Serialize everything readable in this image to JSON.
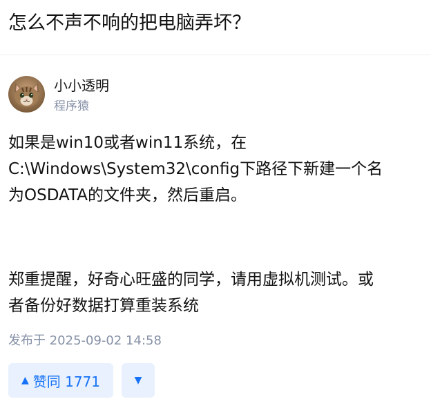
{
  "question": {
    "title": "怎么不声不响的把电脑弄坏？"
  },
  "author": {
    "name": "小小透明",
    "headline": "程序猿",
    "avatar_icon": "cat-avatar-icon"
  },
  "answer": {
    "paragraphs": [
      "如果是win10或者win11系统，在\nC:\\Windows\\System32\\config下路径下新建一个名\n为OSDATA的文件夹，然后重启。",
      "郑重提醒，好奇心旺盛的同学，请用虚拟机测试。或\n者备份好数据打算重装系统"
    ],
    "published": "发布于 2025-09-02 14:58"
  },
  "actions": {
    "upvote_label": "赞同 1771",
    "upvote_icon": "triangle-up-icon",
    "downvote_icon": "triangle-down-icon",
    "accent": "#1772f6",
    "button_bg": "#e8f1fd"
  }
}
